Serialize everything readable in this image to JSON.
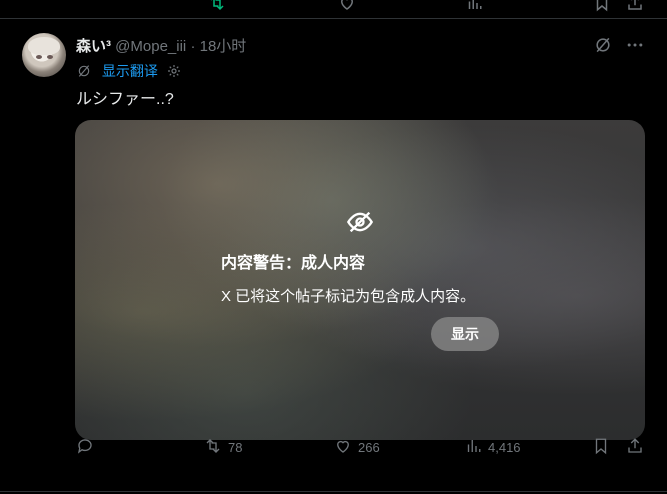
{
  "post": {
    "author_name": "森い³",
    "handle": "@Mope_iii",
    "separator": "·",
    "time": "18小时",
    "translate_label": "显示翻译",
    "text": "ルシファー..?"
  },
  "content_warning": {
    "title": "内容警告：成人内容",
    "message": "X 已将这个帖子标记为包含成人内容。",
    "show_button": "显示"
  },
  "stats": {
    "reposts": "78",
    "likes": "266",
    "views": "4,416"
  },
  "icons": {
    "accent": "#1d9bf0",
    "muted": "#71767b"
  }
}
